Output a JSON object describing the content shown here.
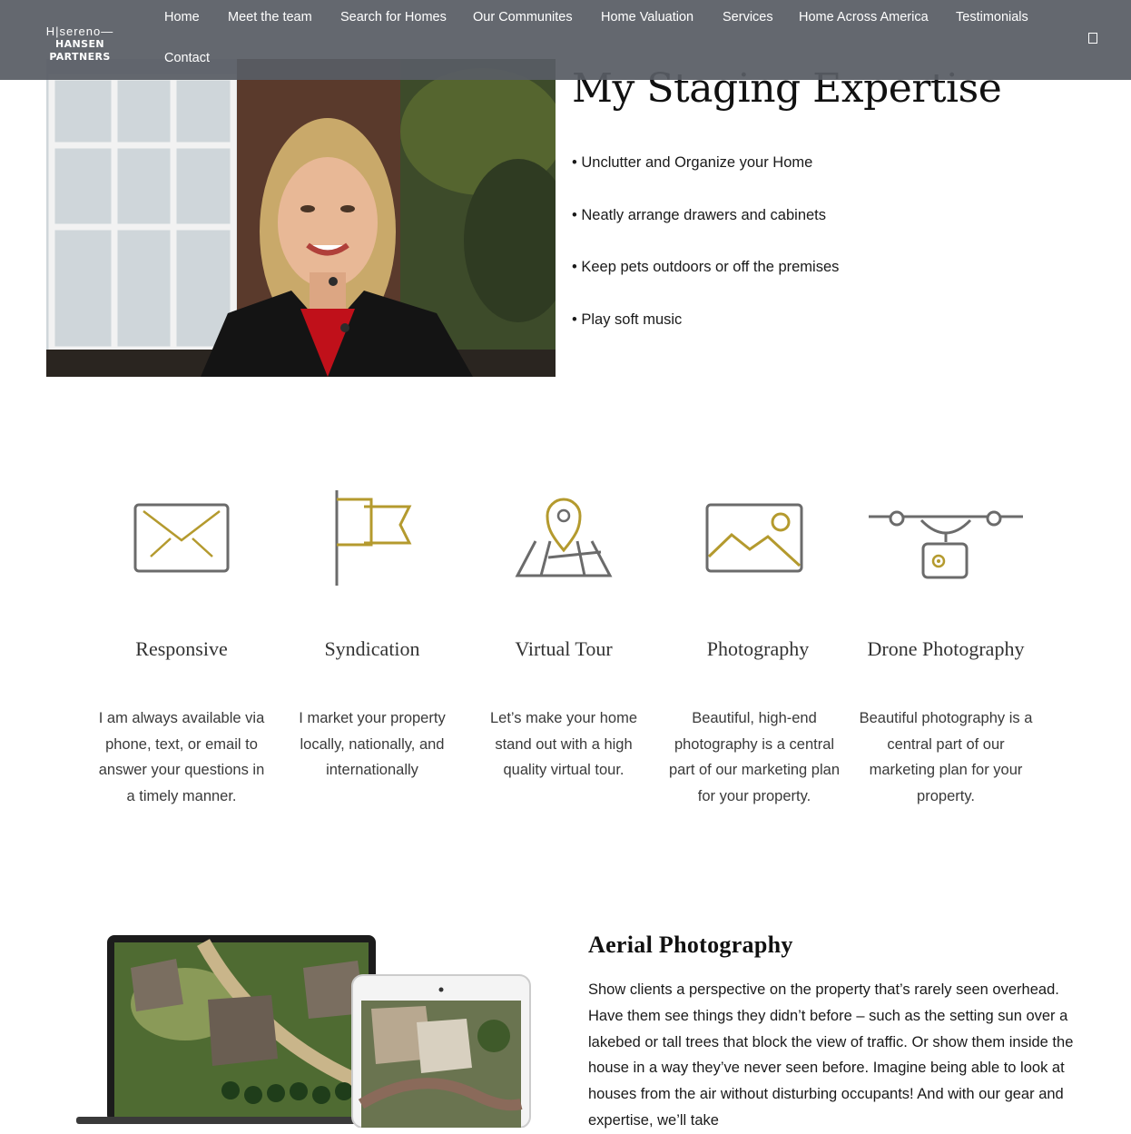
{
  "header": {
    "logo": {
      "line1": "H|sereno—",
      "line2": "HANSEN PARTNERS"
    },
    "nav": [
      {
        "label": "Home"
      },
      {
        "label": "Meet the team"
      },
      {
        "label": "Search for Homes"
      },
      {
        "label": "Our Communites"
      },
      {
        "label": "Home Valuation"
      },
      {
        "label": "Services"
      },
      {
        "label": "Home Across America"
      },
      {
        "label": "Testimonials"
      },
      {
        "label": "Contact"
      }
    ],
    "menu_icon": "square-icon"
  },
  "staging": {
    "title": "My Staging Expertise",
    "bullets": [
      "• Unclutter and Organize your Home",
      "• Neatly arrange drawers and cabinets",
      "• Keep pets outdoors or off the premises",
      "• Play soft music"
    ]
  },
  "features": [
    {
      "icon": "envelope-icon",
      "title": "Responsive",
      "text": "I am always available via phone, text, or email to answer your questions in a timely manner."
    },
    {
      "icon": "flag-icon",
      "title": "Syndication",
      "text": "I market your property locally, nationally, and internationally"
    },
    {
      "icon": "map-pin-icon",
      "title": "Virtual Tour",
      "text": "Let’s make your home stand out with a high quality virtual tour."
    },
    {
      "icon": "image-icon",
      "title": "Photography",
      "text": "Beautiful, high-end photography is a central part of our marketing plan for your property."
    },
    {
      "icon": "drone-icon",
      "title": "Drone Photography",
      "text": "Beautiful photography is a central part of our marketing plan for your property."
    }
  ],
  "aerial": {
    "title": "Aerial Photography",
    "text": "Show clients a perspective on the property that’s rarely seen overhead. Have them see things they didn’t before – such as the setting sun over a lakebed or tall trees that block the view of traffic. Or show them inside the house in a way they’ve never seen before. Imagine being able to look at houses from the air without disturbing occupants! And with our gear and expertise, we’ll take"
  },
  "colors": {
    "gold": "#b49a2e",
    "gray": "#6b6b6b",
    "header_bg": "#585c64"
  }
}
